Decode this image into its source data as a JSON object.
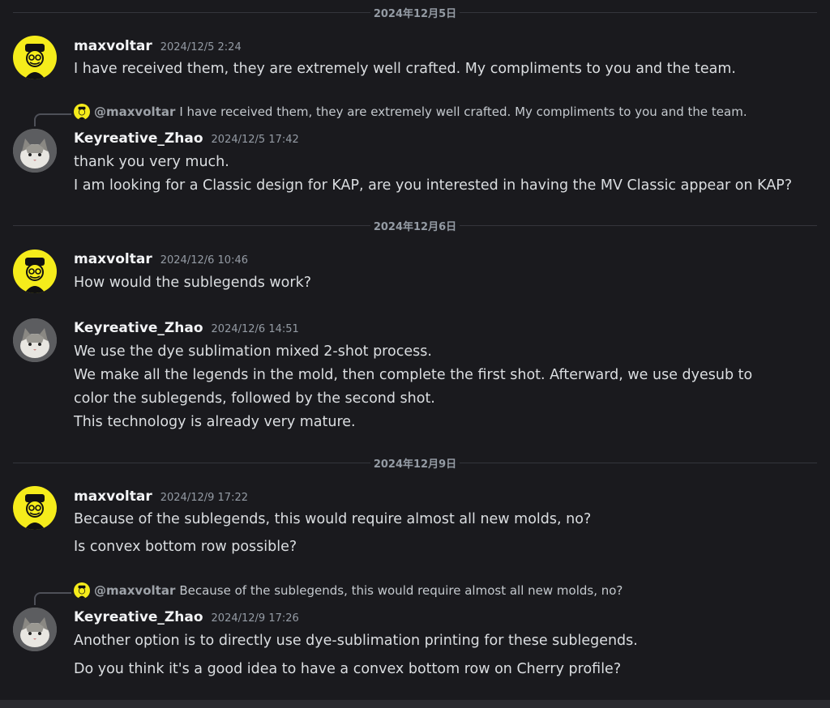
{
  "dates": [
    "2024年12月5日",
    "2024年12月6日",
    "2024年12月9日"
  ],
  "users": {
    "max": {
      "name": "maxvoltar",
      "avatar_color": "#f5ec1b"
    },
    "zhao": {
      "name": "Keyreative_Zhao",
      "avatar_color": "#6d6d6e"
    }
  },
  "messages": [
    {
      "author": "maxvoltar",
      "timestamp": "2024/12/5 2:24",
      "lines": [
        "I have received them, they are extremely well crafted. My compliments to you and the team."
      ]
    },
    {
      "author": "Keyreative_Zhao",
      "timestamp": "2024/12/5 17:42",
      "reply_mention": "@maxvoltar",
      "reply_text": "I have received them, they are extremely well crafted. My compliments to you and the team.",
      "lines": [
        "thank you very much.",
        "I am looking for a Classic design for KAP, are you interested in having the MV Classic appear on KAP?"
      ]
    },
    {
      "author": "maxvoltar",
      "timestamp": "2024/12/6 10:46",
      "lines": [
        "How would the sublegends work?"
      ]
    },
    {
      "author": "Keyreative_Zhao",
      "timestamp": "2024/12/6 14:51",
      "lines": [
        "We use the dye sublimation mixed 2-shot process.",
        "We make all the legends in the mold, then complete the first shot. Afterward, we use dyesub to",
        "color the sublegends, followed by the second shot.",
        "This technology is already very mature."
      ]
    },
    {
      "author": "maxvoltar",
      "timestamp": "2024/12/9 17:22",
      "lines": [
        "Because of the sublegends, this would require almost all new molds, no?",
        "Is convex bottom row possible?"
      ]
    },
    {
      "author": "Keyreative_Zhao",
      "timestamp": "2024/12/9 17:26",
      "reply_mention": "@maxvoltar",
      "reply_text": "Because of the sublegends, this would require almost all new molds, no?",
      "lines": [
        "Another option is to directly use dye-sublimation printing for these sublegends.",
        "Do you think it's a good idea to have a convex bottom row on Cherry profile?"
      ]
    }
  ]
}
